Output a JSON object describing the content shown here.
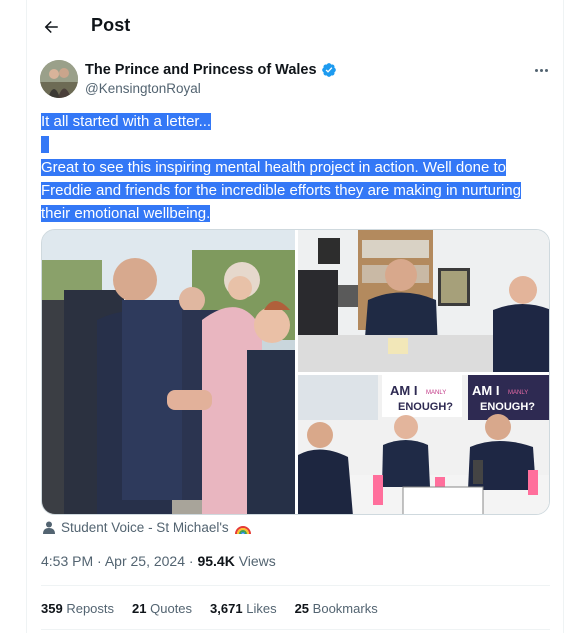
{
  "header": {
    "title": "Post",
    "back_icon": "arrow-left-icon"
  },
  "author": {
    "display_name": "The Prince and Princess of Wales",
    "handle": "@KensingtonRoyal",
    "verified_color": "#1d9bf0",
    "avatar_icon": "profile-photo"
  },
  "tweet": {
    "lines": [
      "It all started with a letter...",
      "",
      "Great to see this inspiring mental health project in action. Well done to",
      "Freddie and friends for the incredible efforts they are making in nurturing",
      "their emotional wellbeing."
    ],
    "selection_color": "#3478f6"
  },
  "media": {
    "images": [
      {
        "alt_icon": "handshake-photo"
      },
      {
        "alt_icon": "classroom-photo"
      },
      {
        "alt_icon": "poster-photo",
        "poster_text": [
          "AM I",
          "MANLY",
          "ENOUGH?"
        ]
      }
    ]
  },
  "tagged": {
    "label": "Student Voice - St Michael's",
    "icon": "person-icon",
    "emoji": "rainbow-icon"
  },
  "meta": {
    "time": "4:53 PM",
    "date": "Apr 25, 2024",
    "separator": "·",
    "views_count": "95.4K",
    "views_label": "Views"
  },
  "stats": {
    "reposts_count": "359",
    "reposts_label": "Reposts",
    "quotes_count": "21",
    "quotes_label": "Quotes",
    "likes_count": "3,671",
    "likes_label": "Likes",
    "bookmarks_count": "25",
    "bookmarks_label": "Bookmarks"
  }
}
